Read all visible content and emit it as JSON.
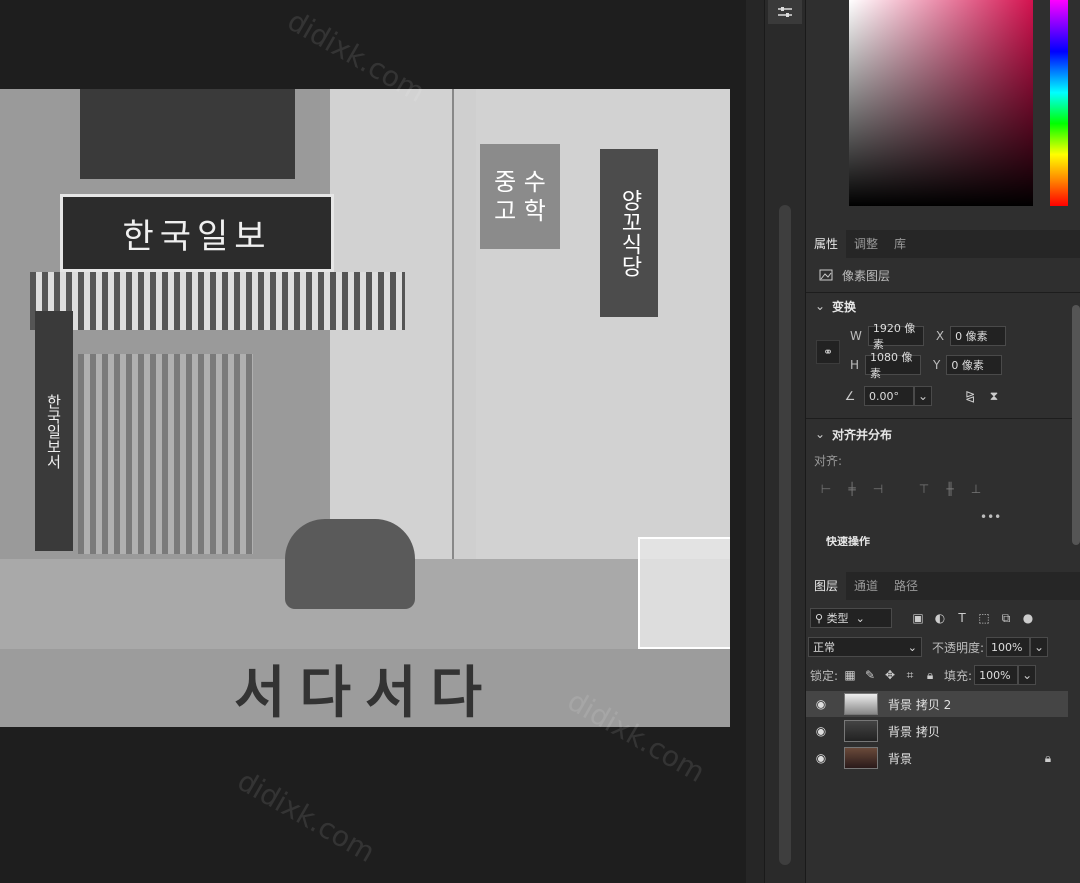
{
  "canvas": {
    "signboard_text": "한국일보",
    "vertical_sign_text": "한국일보서",
    "sign2_text": "중 수\n고 학",
    "sign3_text": "양꼬식당",
    "road_text": "서다서다",
    "watermark": "didixk.com"
  },
  "colors": {
    "accent": "#d3124f",
    "panel_bg": "#2f2f2f",
    "canvas_bg": "#1e1e1e"
  },
  "properties_panel": {
    "tabs": [
      {
        "label": "属性",
        "active": true
      },
      {
        "label": "调整",
        "active": false
      },
      {
        "label": "库",
        "active": false
      }
    ],
    "layer_type_label": "像素图层",
    "transform": {
      "title": "变换",
      "w_label": "W",
      "w_value": "1920 像素",
      "h_label": "H",
      "h_value": "1080 像素",
      "x_label": "X",
      "x_value": "0 像素",
      "y_label": "Y",
      "y_value": "0 像素",
      "angle_value": "0.00°"
    },
    "align": {
      "title": "对齐并分布",
      "sub_label": "对齐:",
      "more": "•••",
      "next_section": "快速操作"
    }
  },
  "layers_panel": {
    "tabs": [
      {
        "label": "图层",
        "active": true
      },
      {
        "label": "通道",
        "active": false
      },
      {
        "label": "路径",
        "active": false
      }
    ],
    "filter_label": "类型",
    "blend_mode": "正常",
    "opacity_label": "不透明度:",
    "opacity_value": "100%",
    "lock_label": "锁定:",
    "fill_label": "填充:",
    "fill_value": "100%",
    "layers": [
      {
        "name": "背景 拷贝 2",
        "selected": true,
        "locked": false
      },
      {
        "name": "背景 拷贝",
        "selected": false,
        "locked": false
      },
      {
        "name": "背景",
        "selected": false,
        "locked": true
      }
    ]
  }
}
